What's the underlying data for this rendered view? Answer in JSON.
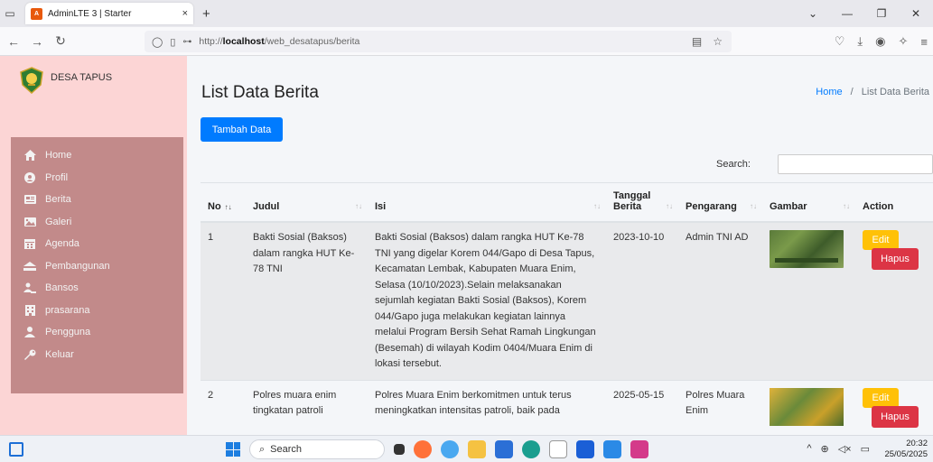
{
  "browser": {
    "tab_title": "AdminLTE 3 | Starter",
    "tab_close": "×",
    "new_tab": "+",
    "url_prefix": "http://",
    "url_host": "localhost",
    "url_path": "/web_desatapus/berita"
  },
  "sidebar": {
    "brand": "DESA TAPUS",
    "items": [
      {
        "label": "Home",
        "icon": "home-icon"
      },
      {
        "label": "Profil",
        "icon": "profile-icon"
      },
      {
        "label": "Berita",
        "icon": "newspaper-icon"
      },
      {
        "label": "Galeri",
        "icon": "image-icon"
      },
      {
        "label": "Agenda",
        "icon": "calendar-icon"
      },
      {
        "label": "Pembangunan",
        "icon": "building-icon"
      },
      {
        "label": "Bansos",
        "icon": "users-icon"
      },
      {
        "label": "prasarana",
        "icon": "facility-icon"
      },
      {
        "label": "Pengguna",
        "icon": "user-icon"
      },
      {
        "label": "Keluar",
        "icon": "key-icon"
      }
    ]
  },
  "main": {
    "title": "List Data Berita",
    "breadcrumb_home": "Home",
    "breadcrumb_sep": "/",
    "breadcrumb_current": "List Data Berita",
    "add_button": "Tambah Data",
    "search_label": "Search:"
  },
  "table": {
    "headers": {
      "no": "No",
      "judul": "Judul",
      "isi": "Isi",
      "tanggal_1": "Tanggal",
      "tanggal_2": "Berita",
      "pengarang": "Pengarang",
      "gambar": "Gambar",
      "action": "Action"
    },
    "rows": [
      {
        "no": "1",
        "judul": "Bakti Sosial (Baksos) dalam rangka HUT Ke-78 TNI",
        "isi": "Bakti Sosial (Baksos) dalam rangka HUT Ke-78 TNI yang digelar Korem 044/Gapo di Desa Tapus, Kecamatan Lembak, Kabupaten Muara Enim, Selasa (10/10/2023).Selain melaksanakan sejumlah kegiatan Bakti Sosial (Baksos), Korem 044/Gapo juga melakukan kegiatan lainnya melalui Program Bersih Sehat Ramah Lingkungan (Besemah) di wilayah Kodim 0404/Muara Enim di lokasi tersebut.",
        "tanggal": "2023-10-10",
        "pengarang": "Admin TNI AD",
        "edit": "Edit",
        "hapus": "Hapus"
      },
      {
        "no": "2",
        "judul": "Polres muara enim tingkatan patroli",
        "isi": "Polres Muara Enim berkomitmen untuk terus meningkatkan intensitas patroli, baik pada",
        "tanggal": "2025-05-15",
        "pengarang": "Polres Muara Enim",
        "edit": "Edit",
        "hapus": "Hapus"
      }
    ]
  },
  "taskbar": {
    "search": "Search",
    "time": "20:32",
    "date": "25/05/2025"
  },
  "colors": {
    "sidebar_bg": "#fcd5d5",
    "menu_bg": "#c28a8a",
    "primary": "#007bff",
    "warning": "#ffc107",
    "danger": "#dc3545"
  }
}
